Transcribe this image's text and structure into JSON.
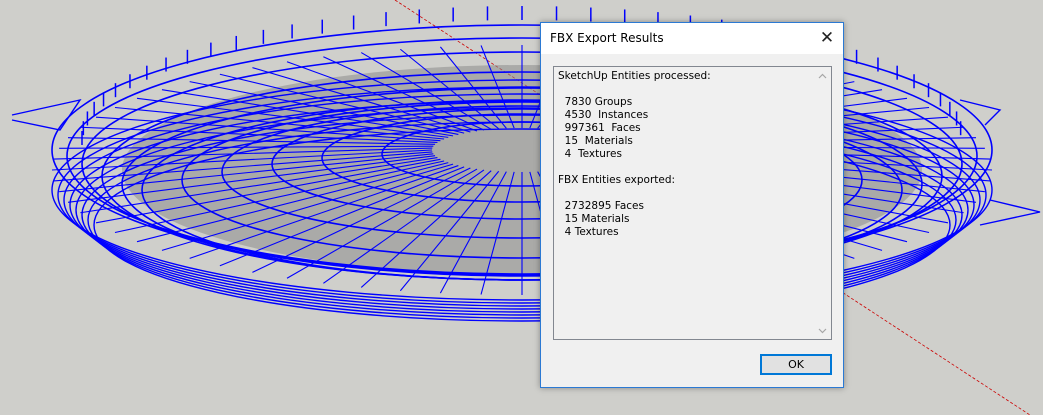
{
  "dialog": {
    "title": "FBX Export Results",
    "close_glyph": "✕",
    "ok_label": "OK",
    "lines": [
      "SketchUp Entities processed:",
      "",
      "  7830 Groups",
      "  4530  Instances",
      "  997361  Faces",
      "  15  Materials",
      "  4  Textures",
      "",
      "FBX Entities exported:",
      "",
      "  2732895 Faces",
      "  15 Materials",
      "  4 Textures"
    ]
  },
  "icons": {
    "close": "close-icon",
    "scroll_up": "scroll-up-icon",
    "scroll_down": "scroll-down-icon"
  },
  "colors": {
    "background": "#cfcfcb",
    "wireframe": "#0000ff",
    "axis": "#cc0000",
    "dialog_border": "#2b79d3",
    "button_border": "#0078d7"
  }
}
